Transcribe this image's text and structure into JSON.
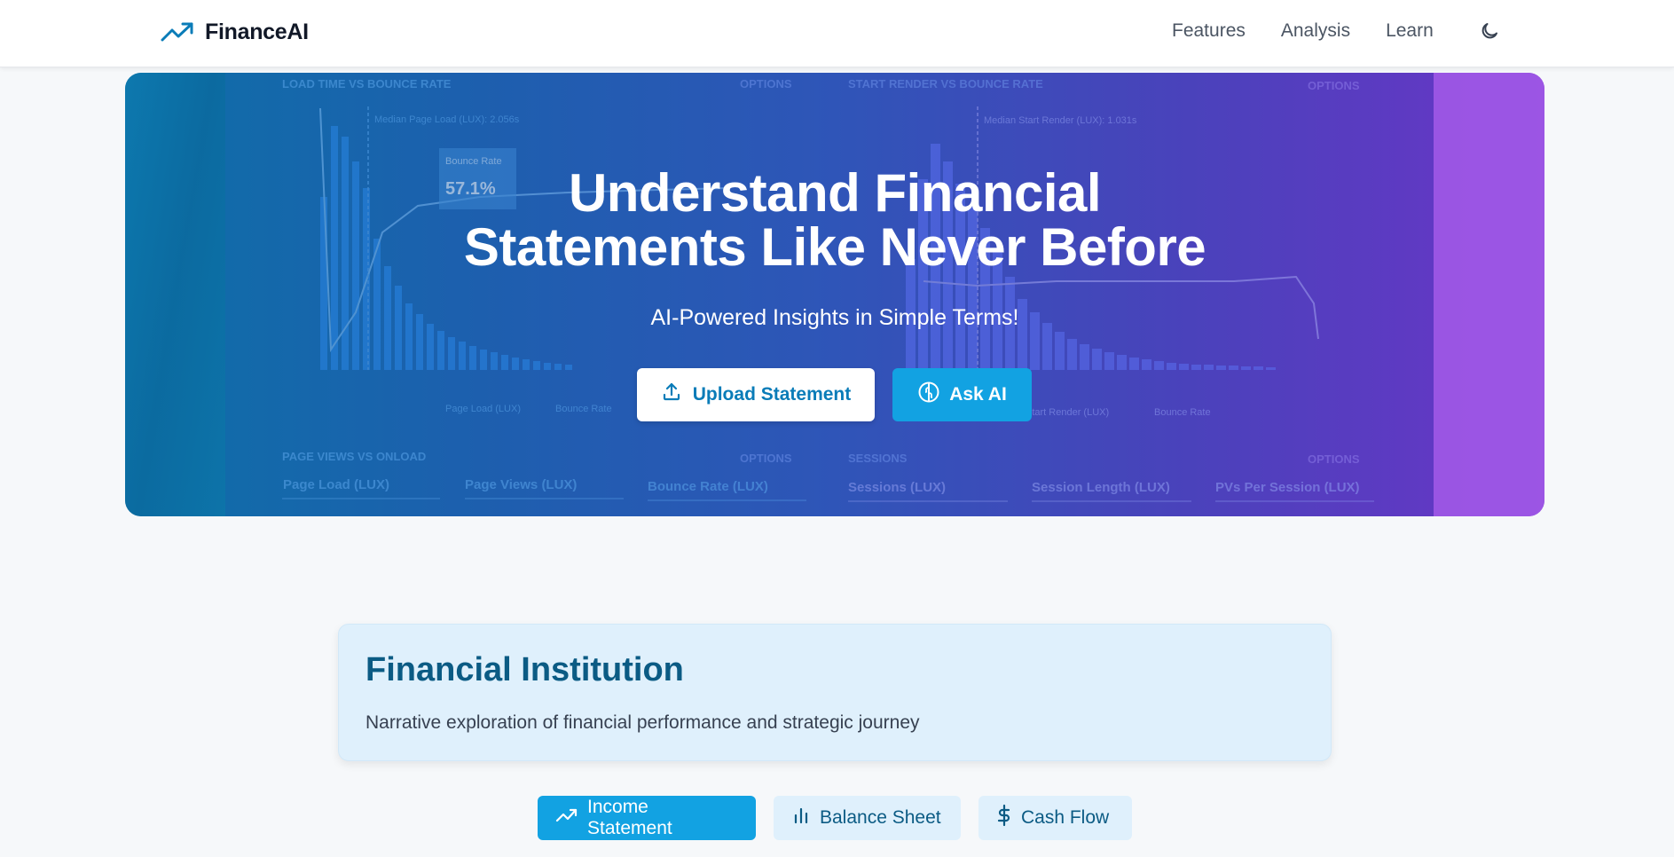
{
  "navbar": {
    "brand": "FinanceAI",
    "links": [
      "Features",
      "Analysis",
      "Learn"
    ],
    "theme_icon": "moon-icon"
  },
  "hero": {
    "title_line1": "Understand Financial",
    "title_line2": "Statements Like Never Before",
    "subtitle": "AI-Powered Insights in Simple Terms!",
    "upload_label": "Upload Statement",
    "ask_label": "Ask AI",
    "background": {
      "panel1_title": "LOAD TIME VS BOUNCE RATE",
      "panel2_title": "START RENDER VS BOUNCE RATE",
      "panel3_title": "PAGE VIEWS VS ONLOAD",
      "panel4_title": "SESSIONS",
      "options_label": "OPTIONS",
      "median1": "Median Page Load (LUX): 2.056s",
      "median2": "Median Start Render (LUX): 1.031s",
      "tooltip_label": "Bounce Rate",
      "tooltip_value": "57.1%",
      "legend1": "Page Load (LUX)",
      "legend2": "Bounce Rate",
      "legend3": "Start Render (LUX)",
      "metric1": "Page Load (LUX)",
      "metric2": "Page Views (LUX)",
      "metric3": "Bounce Rate (LUX)",
      "metric4": "Sessions (LUX)",
      "metric5": "Session Length (LUX)",
      "metric6": "PVs Per Session (LUX)"
    }
  },
  "info_card": {
    "title": "Financial Institution",
    "description": "Narrative exploration of financial performance and strategic journey"
  },
  "tabs": {
    "income": "Income Statement",
    "balance": "Balance Sheet",
    "cash": "Cash Flow"
  },
  "colors": {
    "accent": "#12a2e2",
    "brand_icon": "#0a7cb8",
    "card_title": "#0b5b84"
  }
}
